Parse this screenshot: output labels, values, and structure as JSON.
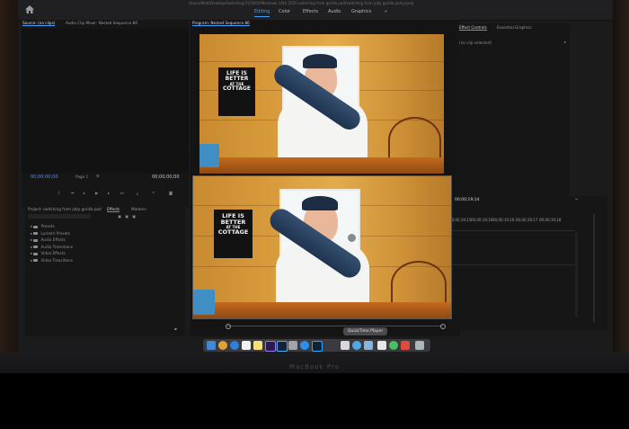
{
  "window": {
    "title_path": "/Users/Matt/Desktop/Switching/15/2020/Macbook 10th 2020 switching from gorilla pod/switching from joby gorilla pod.prproj"
  },
  "workspaces": [
    {
      "label": "Editing"
    },
    {
      "label": "Color"
    },
    {
      "label": "Effects"
    },
    {
      "label": "Audio"
    },
    {
      "label": "Graphics"
    }
  ],
  "source_panel": {
    "tabs": [
      {
        "label": "Source: (no clips)"
      },
      {
        "label": "Audio Clip Mixer: Nested Sequence 86"
      }
    ],
    "timecode_left": "00;00;00;00",
    "fit_label": "Page 1",
    "timecode_right": "00;00;00;00"
  },
  "program_panel": {
    "title": "Program: Nested Sequence 86"
  },
  "effect_controls": {
    "tabs": [
      {
        "label": "Effect Controls"
      },
      {
        "label": "Essential Graphics"
      }
    ],
    "no_clip": "(no clip selected)"
  },
  "project_panel": {
    "tabs": [
      {
        "label": "Project: switching from joby gorilla pod"
      },
      {
        "label": "Effects"
      },
      {
        "label": "Markers"
      }
    ],
    "folders": [
      {
        "label": "Presets"
      },
      {
        "label": "Lumetri Presets"
      },
      {
        "label": "Audio Effects"
      },
      {
        "label": "Audio Transitions"
      },
      {
        "label": "Video Effects"
      },
      {
        "label": "Video Transitions"
      }
    ]
  },
  "timeline": {
    "timecode": "00;00;19;14",
    "ruler": [
      "00;00;19;15",
      "00;00;19;16",
      "00;00;19;16",
      "00;00;19;17",
      "00;00;19;18"
    ]
  },
  "poster_text": [
    "LIFE IS",
    "BETTER",
    "AT THE",
    "COTTAGE"
  ],
  "quicktime": {
    "label": "QuickTime Player"
  },
  "laptop": {
    "brand": "MacBook Pro"
  },
  "colors": {
    "accent": "#3ea0ff",
    "timecode": "#5d8de0"
  },
  "dock_icons": [
    "finder-icon",
    "chrome-icon",
    "safari-icon",
    "calendar-icon",
    "notes-icon",
    "premiere-icon",
    "lightroom-icon",
    "photo-icon",
    "appstore-icon",
    "photoshop-icon",
    "clapper-icon",
    "preview-icon",
    "messages-icon",
    "facetime-icon",
    "pages-icon",
    "maps-icon",
    "music-icon",
    "trash-icon"
  ]
}
